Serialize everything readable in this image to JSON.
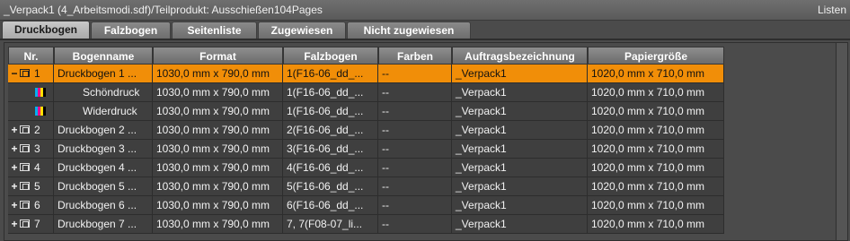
{
  "window": {
    "title": "_Verpack1 (4_Arbeitsmodi.sdf)/Teilprodukt: Ausschießen104Pages",
    "view_label": "Listen"
  },
  "tabs": [
    {
      "label": "Druckbogen",
      "active": true
    },
    {
      "label": "Falzbogen",
      "active": false
    },
    {
      "label": "Seitenliste",
      "active": false
    },
    {
      "label": "Zugewiesen",
      "active": false
    },
    {
      "label": "Nicht zugewiesen",
      "active": false
    }
  ],
  "table": {
    "columns": [
      "Nr.",
      "Bogenname",
      "Format",
      "Falzbogen",
      "Farben",
      "Auftragsbezeichnung",
      "Papiergröße"
    ],
    "rows": [
      {
        "expander": "−",
        "nr": "1",
        "name": "Druckbogen 1 ...",
        "format": "1030,0 mm x 790,0 mm",
        "falzbogen": "1(F16-06_dd_...",
        "farben": "--",
        "auftrag": "_Verpack1",
        "papier": "1020,0 mm x 710,0 mm",
        "kind": "sheet",
        "selected": true
      },
      {
        "expander": "",
        "nr": "",
        "name": "Schöndruck",
        "format": "1030,0 mm x 790,0 mm",
        "falzbogen": "1(F16-06_dd_...",
        "farben": "--",
        "auftrag": "_Verpack1",
        "papier": "1020,0 mm x 710,0 mm",
        "kind": "side",
        "selected": false
      },
      {
        "expander": "",
        "nr": "",
        "name": "Widerdruck",
        "format": "1030,0 mm x 790,0 mm",
        "falzbogen": "1(F16-06_dd_...",
        "farben": "--",
        "auftrag": "_Verpack1",
        "papier": "1020,0 mm x 710,0 mm",
        "kind": "side",
        "selected": false
      },
      {
        "expander": "+",
        "nr": "2",
        "name": "Druckbogen 2 ...",
        "format": "1030,0 mm x 790,0 mm",
        "falzbogen": "2(F16-06_dd_...",
        "farben": "--",
        "auftrag": "_Verpack1",
        "papier": "1020,0 mm x 710,0 mm",
        "kind": "sheet",
        "selected": false
      },
      {
        "expander": "+",
        "nr": "3",
        "name": "Druckbogen 3 ...",
        "format": "1030,0 mm x 790,0 mm",
        "falzbogen": "3(F16-06_dd_...",
        "farben": "--",
        "auftrag": "_Verpack1",
        "papier": "1020,0 mm x 710,0 mm",
        "kind": "sheet",
        "selected": false
      },
      {
        "expander": "+",
        "nr": "4",
        "name": "Druckbogen 4 ...",
        "format": "1030,0 mm x 790,0 mm",
        "falzbogen": "4(F16-06_dd_...",
        "farben": "--",
        "auftrag": "_Verpack1",
        "papier": "1020,0 mm x 710,0 mm",
        "kind": "sheet",
        "selected": false
      },
      {
        "expander": "+",
        "nr": "5",
        "name": "Druckbogen 5 ...",
        "format": "1030,0 mm x 790,0 mm",
        "falzbogen": "5(F16-06_dd_...",
        "farben": "--",
        "auftrag": "_Verpack1",
        "papier": "1020,0 mm x 710,0 mm",
        "kind": "sheet",
        "selected": false
      },
      {
        "expander": "+",
        "nr": "6",
        "name": "Druckbogen 6 ...",
        "format": "1030,0 mm x 790,0 mm",
        "falzbogen": "6(F16-06_dd_...",
        "farben": "--",
        "auftrag": "_Verpack1",
        "papier": "1020,0 mm x 710,0 mm",
        "kind": "sheet",
        "selected": false
      },
      {
        "expander": "+",
        "nr": "7",
        "name": "Druckbogen 7 ...",
        "format": "1030,0 mm x 790,0 mm",
        "falzbogen": "7, 7(F08-07_li...",
        "farben": "--",
        "auftrag": "_Verpack1",
        "papier": "1020,0 mm x 710,0 mm",
        "kind": "sheet",
        "selected": false
      }
    ]
  },
  "colors": {
    "selection": "#f18e08",
    "cmyk": [
      "#00aeef",
      "#ec008c",
      "#ffde00",
      "#000000"
    ]
  },
  "icons": {
    "sheet": "sheet-icon",
    "side": "cmyk-color-icon"
  }
}
